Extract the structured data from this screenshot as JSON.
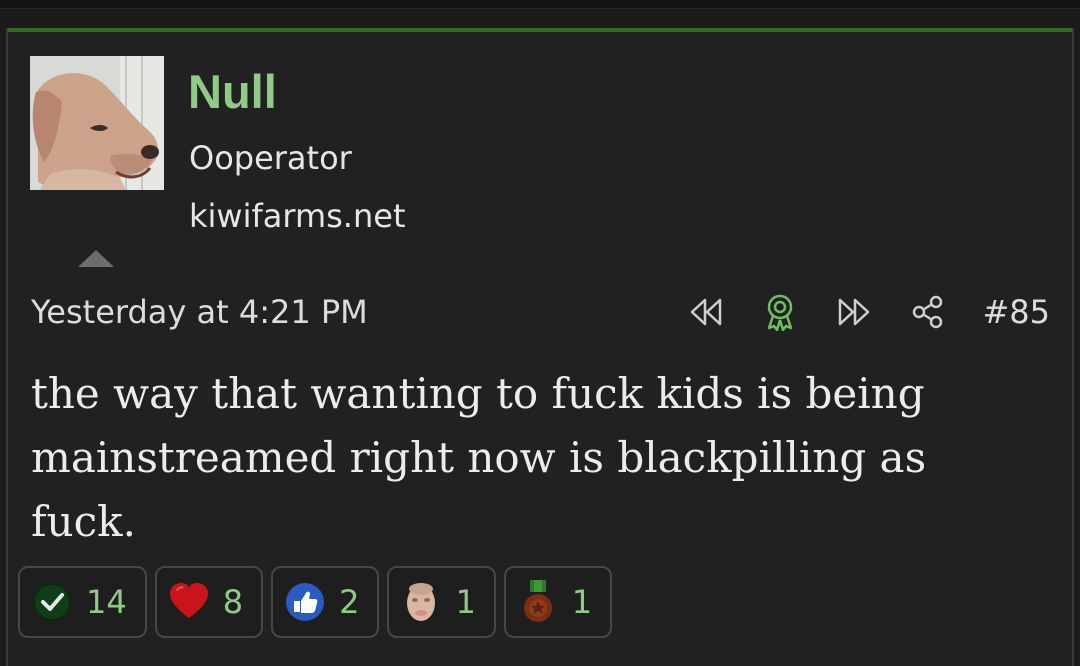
{
  "post": {
    "author": {
      "name": "Null",
      "title": "Ooperator",
      "site": "kiwifarms.net",
      "avatar_icon": "dog-avatar"
    },
    "date": "Yesterday at 4:21 PM",
    "number": "#85",
    "body": "the way that wanting to fuck kids is being mainstreamed right now is blackpilling as fuck.",
    "actions": [
      "rewind-icon",
      "award-icon",
      "fast-forward-icon",
      "share-icon"
    ],
    "reactions": [
      {
        "icon": "checkmark-icon",
        "count": "14"
      },
      {
        "icon": "heart-icon",
        "count": "8"
      },
      {
        "icon": "thumbs-up-icon",
        "count": "2"
      },
      {
        "icon": "face-icon",
        "count": "1"
      },
      {
        "icon": "medal-icon",
        "count": "1"
      }
    ]
  },
  "colors": {
    "accent": "#2f6b24",
    "username": "#8fcb84",
    "text": "#ececec",
    "background": "#212121"
  }
}
